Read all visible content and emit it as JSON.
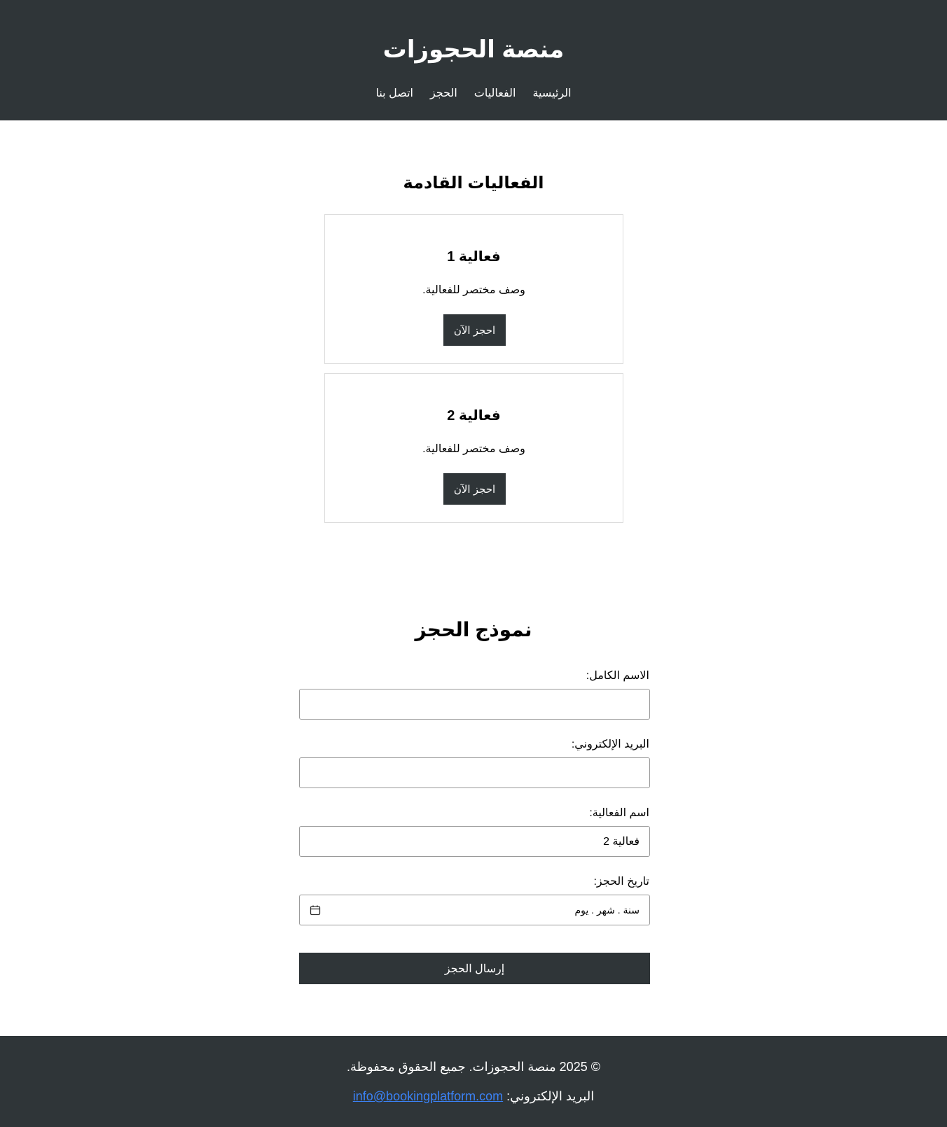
{
  "header": {
    "title": "منصة الحجوزات",
    "nav": [
      {
        "label": "الرئيسية"
      },
      {
        "label": "الفعاليات"
      },
      {
        "label": "الحجز"
      },
      {
        "label": "اتصل بنا"
      }
    ]
  },
  "events": {
    "title": "الفعاليات القادمة",
    "items": [
      {
        "name": "فعالية 1",
        "description": "وصف مختصر للفعالية.",
        "button": "احجز الآن"
      },
      {
        "name": "فعالية 2",
        "description": "وصف مختصر للفعالية.",
        "button": "احجز الآن"
      }
    ]
  },
  "form": {
    "title": "نموذج الحجز",
    "name_label": "الاسم الكامل:",
    "name_value": "",
    "email_label": "البريد الإلكتروني:",
    "email_value": "",
    "event_label": "اسم الفعالية:",
    "event_value": "فعالية 2",
    "date_label": "تاريخ الحجز:",
    "date_placeholder": "سنة . شهر . يوم",
    "submit": "إرسال الحجز"
  },
  "footer": {
    "copyright": "© 2025 منصة الحجوزات. جميع الحقوق محفوظة.",
    "email_label": "البريد الإلكتروني:",
    "email": "info@bookingplatform.com"
  },
  "colors": {
    "dark": "#2f3538",
    "link": "#3b82f6"
  }
}
